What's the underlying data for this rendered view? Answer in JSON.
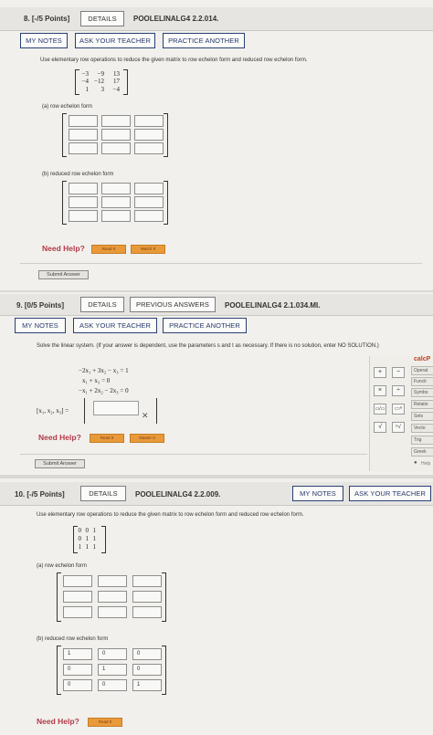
{
  "q8": {
    "number_points": "8. [-/5 Points]",
    "details": "DETAILS",
    "code": "POOLELINALG4 2.2.014.",
    "my_notes": "MY NOTES",
    "ask_teacher": "ASK YOUR TEACHER",
    "practice": "PRACTICE ANOTHER",
    "instruction": "Use elementary row operations to reduce the given matrix to row echelon form and reduced row echelon form.",
    "matrix": [
      [
        "−3",
        "−9",
        "13"
      ],
      [
        "−4",
        "−12",
        "17"
      ],
      [
        "1",
        "3",
        "−4"
      ]
    ],
    "part_a": "(a)   row echelon form",
    "part_b": "(b)   reduced row echelon form",
    "need_help": "Need Help?",
    "read_it": "Read It",
    "watch_it": "Watch It",
    "submit": "Submit Answer"
  },
  "q9": {
    "number_points": "9. [0/5 Points]",
    "details": "DETAILS",
    "previous": "PREVIOUS ANSWERS",
    "code": "POOLELINALG4 2.1.034.MI.",
    "my_notes": "MY NOTES",
    "ask_teacher": "ASK YOUR TEACHER",
    "practice": "PRACTICE ANOTHER",
    "instruction": "Solve the linear system. (If your answer is dependent, use the parameters s and t as necessary. If there is no solution, enter NO SOLUTION.)",
    "equations": [
      "−2x₁ + 3x₂ −   x₃ = 1",
      "x₁             +   x₃ = 0",
      "−x₁ + 2x₂ − 2x₃ = 0"
    ],
    "answer_label": "[x₁, x₂, x₃] =",
    "need_help": "Need Help?",
    "read_it": "Read It",
    "master_it": "Master It",
    "submit": "Submit Answer",
    "calc": {
      "title": "calcP",
      "tabs": [
        "Operat",
        "Functi",
        "Symbo",
        "Relatio",
        "Sets",
        "Vecto",
        "Trig",
        "Greek"
      ],
      "help": "Help"
    }
  },
  "q10": {
    "number_points": "10. [-/5 Points]",
    "details": "DETAILS",
    "code": "POOLELINALG4 2.2.009.",
    "my_notes": "MY NOTES",
    "ask_teacher": "ASK YOUR TEACHER",
    "instruction": "Use elementary row operations to reduce the given matrix to row echelon form and reduced row echelon form.",
    "matrix": [
      [
        "0",
        "0",
        "1"
      ],
      [
        "0",
        "1",
        "1"
      ],
      [
        "1",
        "1",
        "1"
      ]
    ],
    "part_a": "(a)   row echelon form",
    "part_b": "(b)   reduced row echelon form",
    "rref_values": [
      [
        "1",
        "0",
        "0"
      ],
      [
        "0",
        "1",
        "0"
      ],
      [
        "0",
        "0",
        "1"
      ]
    ],
    "need_help": "Need Help?",
    "read_it": "Read It"
  },
  "colors": {
    "accent": "#2b3f73",
    "help_red": "#b23a4a",
    "help_button": "#e89a3b"
  }
}
